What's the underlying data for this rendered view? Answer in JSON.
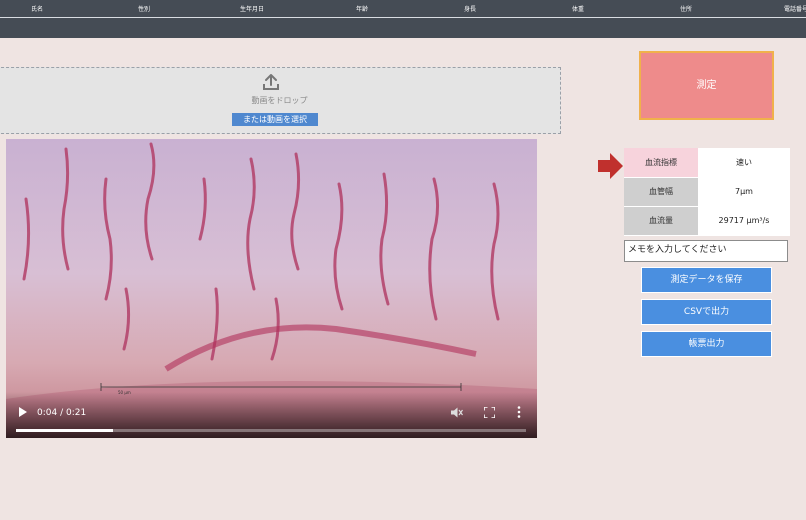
{
  "header": {
    "columns": [
      "氏名",
      "性別",
      "生年月日",
      "年齢",
      "身長",
      "体重",
      "住所",
      "電話番号"
    ]
  },
  "dropzone": {
    "drop_text": "動画をドロップ",
    "select_label": "または動画を選択",
    "icon": "upload-icon"
  },
  "video": {
    "time": "0:04 / 0:21",
    "progress": 0.19,
    "scale_text": "50 μm"
  },
  "measure": {
    "label": "測定"
  },
  "results": {
    "rows": [
      {
        "label": "血流指標",
        "value": "速い"
      },
      {
        "label": "血管幅",
        "value": "7μm"
      },
      {
        "label": "血流量",
        "value": "29717 μm³/s"
      }
    ]
  },
  "memo": {
    "placeholder": "メモを入力してください",
    "value": ""
  },
  "actions": {
    "save": "測定データを保存",
    "csv": "CSVで出力",
    "report": "帳票出力"
  },
  "colors": {
    "header_bg": "#454c55",
    "page_bg": "#efe4e2",
    "measure_bg": "#ee8b8b",
    "measure_border": "#f0b14b",
    "action_bg": "#4a8fe0",
    "highlight_bg": "#f7d3dc",
    "arrow": "#c0302d"
  }
}
